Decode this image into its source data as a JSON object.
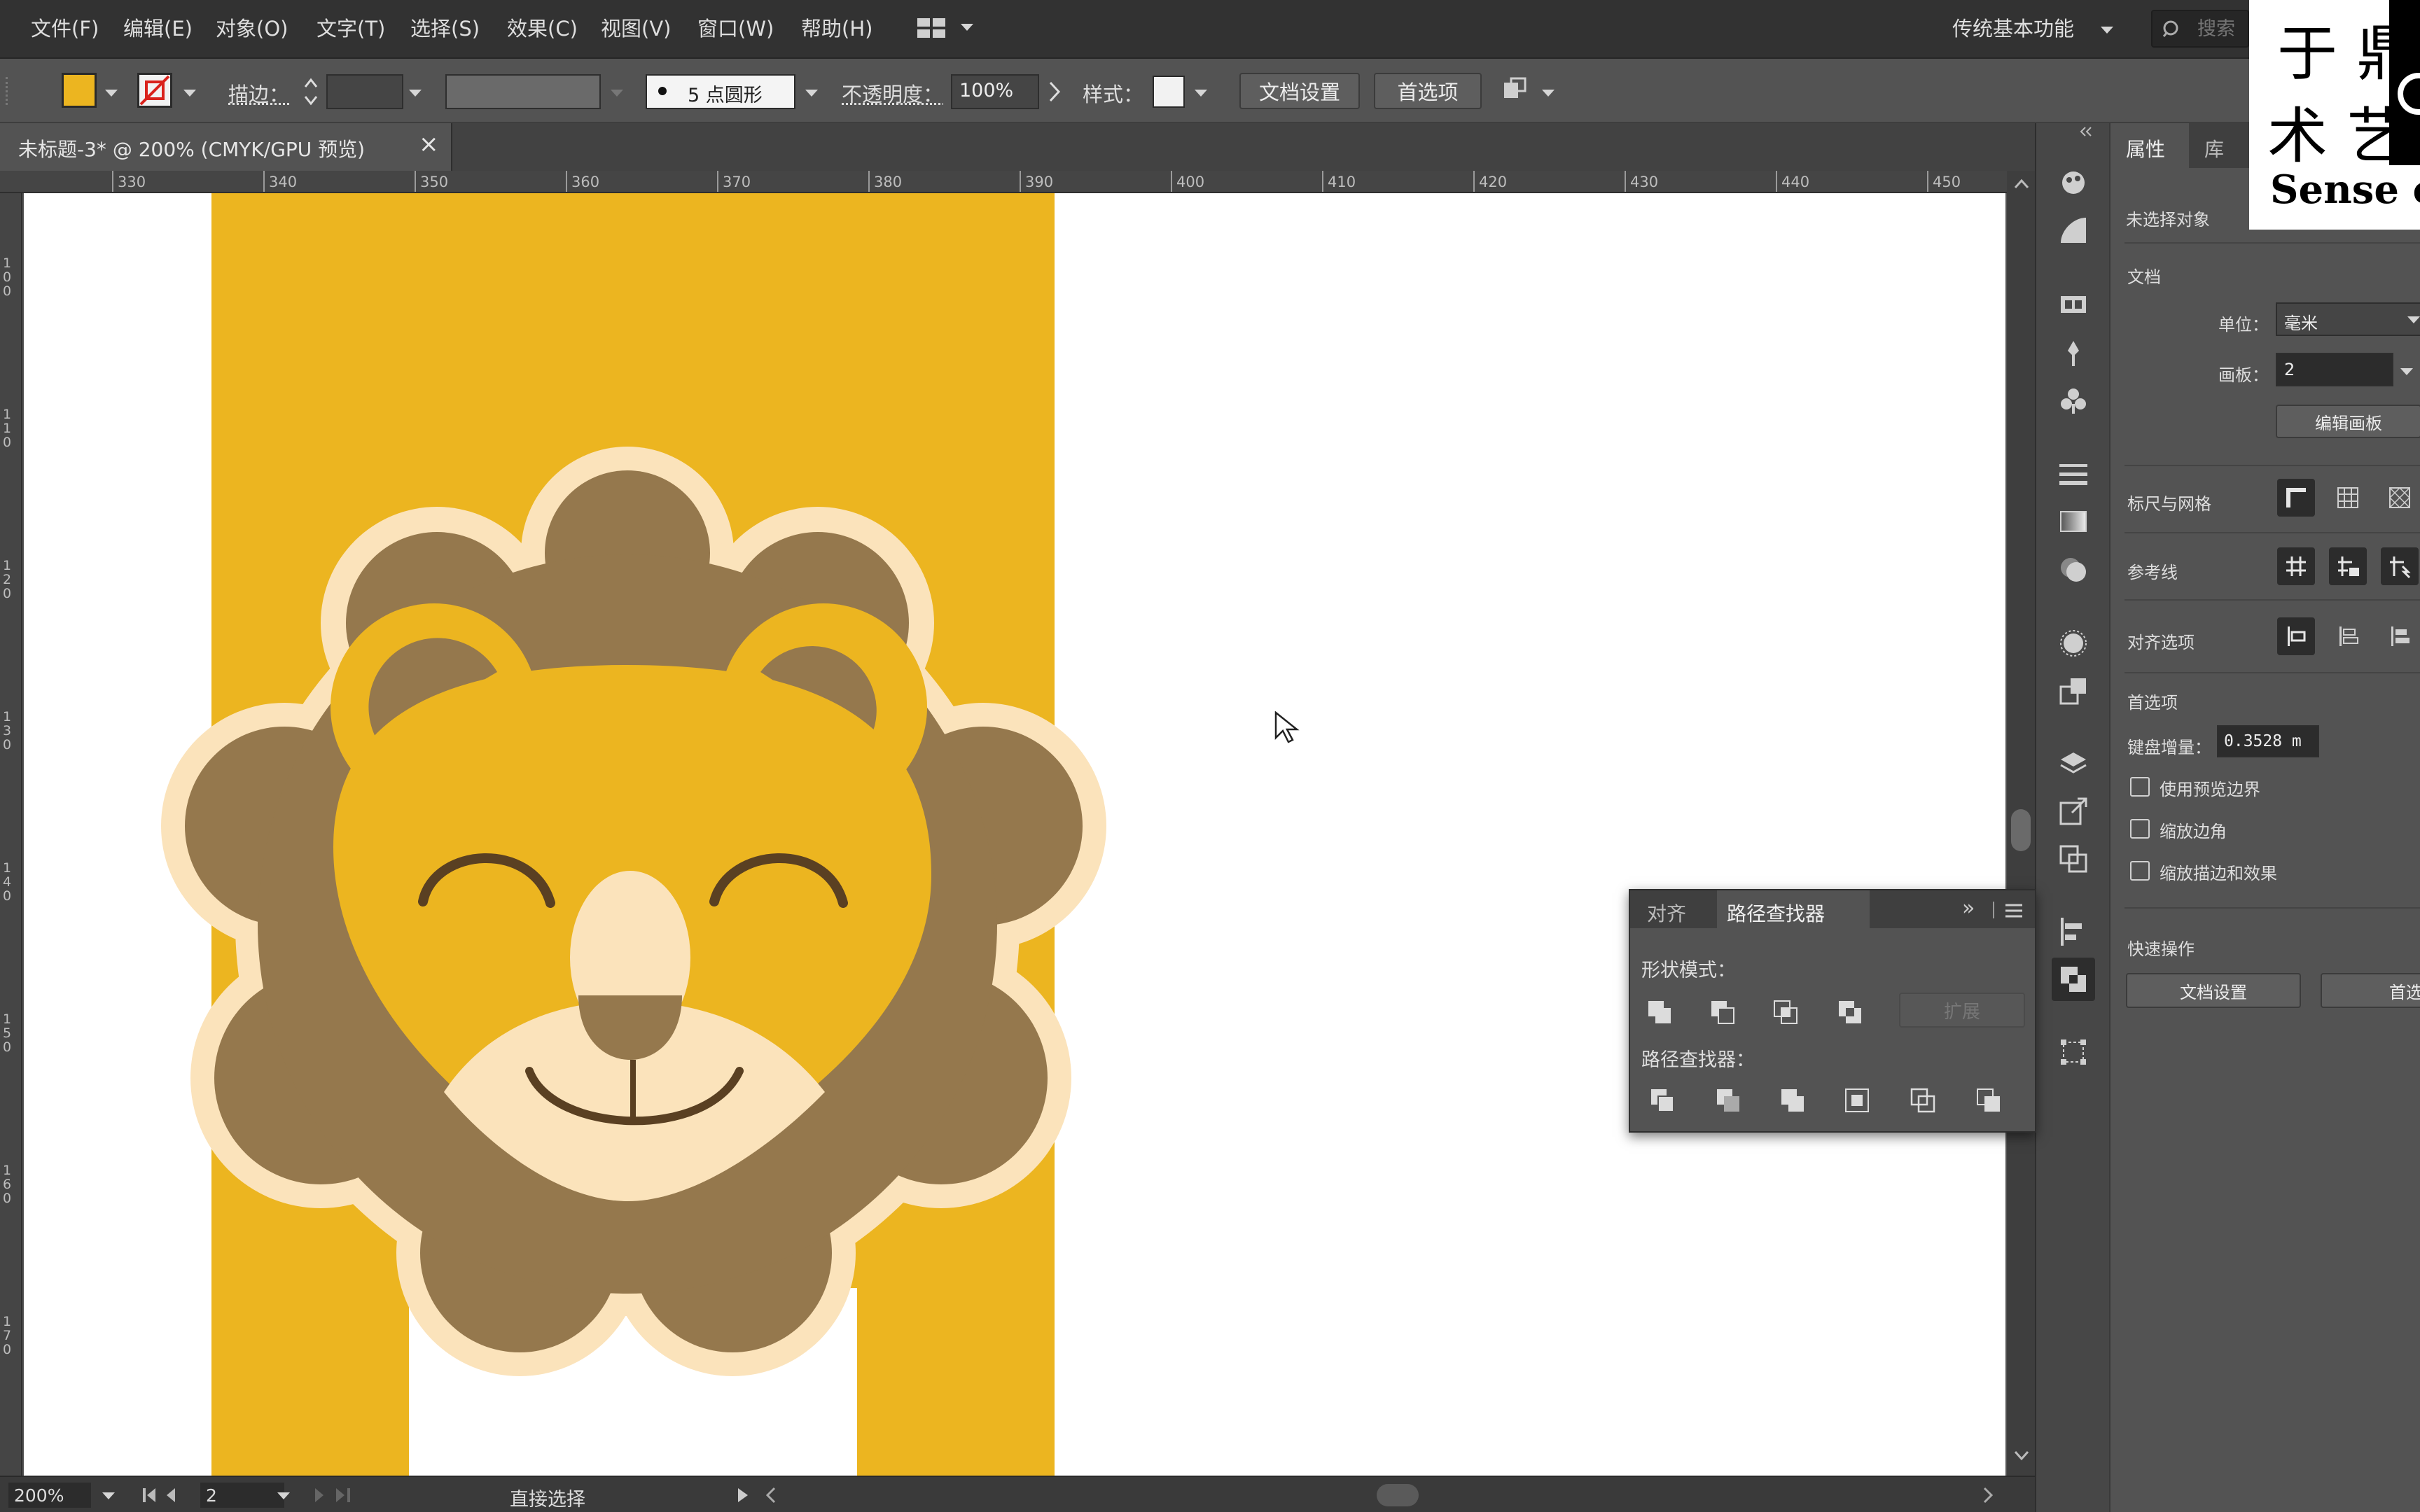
{
  "menu": {
    "items": [
      "文件(F)",
      "编辑(E)",
      "对象(O)",
      "文字(T)",
      "选择(S)",
      "效果(C)",
      "视图(V)",
      "窗口(W)",
      "帮助(H)"
    ],
    "workspace": "传统基本功能",
    "search_placeholder": "搜索"
  },
  "control_bar": {
    "fill_color": "#ecb520",
    "stroke_label": "描边：",
    "brush": "5 点圆形",
    "opacity_label": "不透明度：",
    "opacity_value": "100%",
    "style_label": "样式：",
    "doc_setup": "文档设置",
    "preferences": "首选项"
  },
  "document": {
    "tab_title": "未标题-3* @ 200% (CMYK/GPU 预览)",
    "ruler_ticks": [
      "330",
      "340",
      "350",
      "360",
      "370",
      "380",
      "390",
      "400",
      "410",
      "420",
      "430",
      "440",
      "450"
    ],
    "ruler_left": [
      "1\n0\n0",
      "1\n1\n0",
      "1\n2\n0",
      "1\n3\n0",
      "1\n4\n0",
      "1\n5\n0",
      "1\n6\n0",
      "1\n7\n0"
    ]
  },
  "status": {
    "zoom": "200%",
    "artboard": "2",
    "tool": "直接选择"
  },
  "properties": {
    "tab_properties": "属性",
    "tab_library": "库",
    "no_selection": "未选择对象",
    "doc_section": "文档",
    "units_label": "单位：",
    "units_value": "毫米",
    "artboard_label": "画板：",
    "artboard_value": "2",
    "edit_artboards": "编辑画板",
    "rulers_grids": "标尺与网格",
    "guides": "参考线",
    "align_options": "对齐选项",
    "preferences_section": "首选项",
    "keyboard_increment_label": "键盘增量：",
    "keyboard_increment_value": "0.3528 m",
    "use_preview_bounds": "使用预览边界",
    "scale_corners": "缩放边角",
    "scale_strokes": "缩放描边和效果",
    "quick_actions": "快速操作",
    "qa_doc_setup": "文档设置",
    "qa_preferences": "首选项"
  },
  "pathfinder": {
    "tab_align": "对齐",
    "tab_pathfinder": "路径查找器",
    "shape_modes": "形状模式：",
    "expand": "扩展",
    "pathfinders": "路径查找器："
  },
  "logo": {
    "text_line1": "于 鼎",
    "text_line2": "术 艺",
    "text_line3": "Sense o"
  },
  "colors": {
    "yellow": "#ecb520",
    "mane": "#95784d",
    "cream": "#fbe3bb",
    "dark": "#5a4022"
  }
}
